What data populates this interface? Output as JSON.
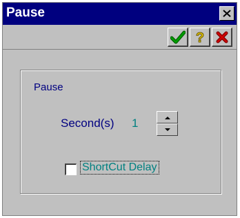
{
  "window": {
    "title": "Pause"
  },
  "toolbar": {
    "ok_icon": "checkmark-icon",
    "help_icon": "question-mark-icon",
    "cancel_icon": "red-x-icon"
  },
  "group": {
    "label": "Pause"
  },
  "seconds": {
    "label": "Second(s)",
    "value": "1"
  },
  "shortcut_delay": {
    "label": "ShortCut Delay",
    "checked": false
  },
  "colors": {
    "titlebar": "#00007f",
    "face": "#c0c0c0",
    "label_navy": "#000080",
    "value_teal": "#008080",
    "ok_green": "#008000",
    "help_yellow": "#c8a800",
    "cancel_red": "#c00000"
  }
}
